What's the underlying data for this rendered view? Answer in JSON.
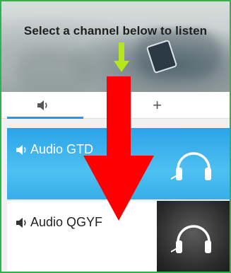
{
  "hero": {
    "title": "Select a channel below to listen"
  },
  "tabs": [
    {
      "icon": "speaker-icon",
      "active": true
    },
    {
      "label": "+",
      "icon": "plus-icon",
      "active": false
    }
  ],
  "channels": [
    {
      "label": "Audio GTD",
      "icon": "speaker-icon",
      "thumb_icon": "headphones-icon",
      "style": "blue"
    },
    {
      "label": "Audio QGYF",
      "icon": "speaker-icon",
      "thumb_icon": "headphones-icon",
      "style": "white"
    }
  ],
  "colors": {
    "frame_border": "#2fb24a",
    "tab_accent": "#2196f3",
    "overlay_arrow": "#ff0000",
    "hint_arrow": "#b5e61d"
  }
}
